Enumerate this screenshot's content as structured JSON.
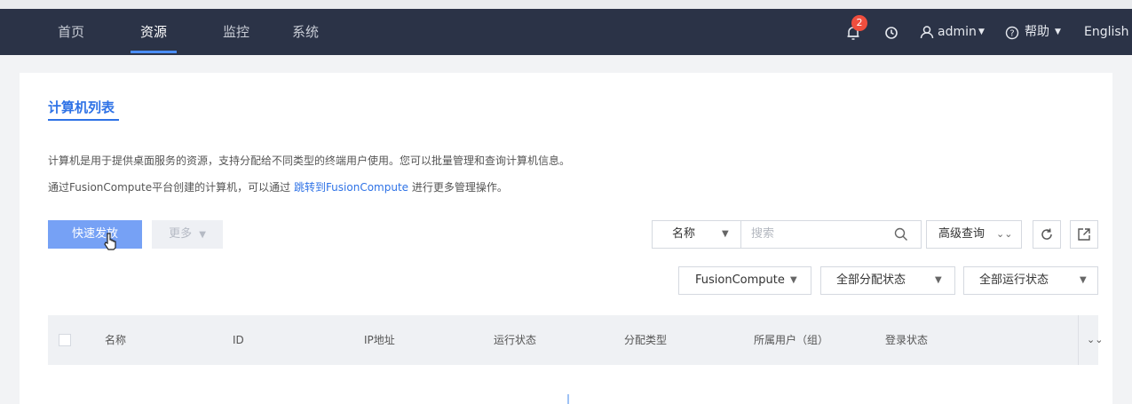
{
  "nav": {
    "tabs": [
      {
        "label": "首页"
      },
      {
        "label": "资源",
        "active": true
      },
      {
        "label": "监控"
      },
      {
        "label": "系统"
      }
    ],
    "notification_count": "2",
    "user": "admin",
    "help": "帮助",
    "language": "English"
  },
  "page": {
    "title": "计算机列表",
    "desc_line1": "计算机是用于提供桌面服务的资源，支持分配给不同类型的终端用户使用。您可以批量管理和查询计算机信息。",
    "desc_line2_prefix": "通过FusionCompute平台创建的计算机，可以通过",
    "desc_line2_link": "跳转到FusionCompute",
    "desc_line2_suffix": "进行更多管理操作。"
  },
  "toolbar": {
    "quick_dispatch": "快速发放",
    "more": "更多",
    "search_field": "名称",
    "search_placeholder": "搜索",
    "advanced": "高级查询",
    "filter_platform": "FusionCompute",
    "filter_assign": "全部分配状态",
    "filter_run": "全部运行状态"
  },
  "table": {
    "columns": [
      "名称",
      "ID",
      "IP地址",
      "运行状态",
      "分配类型",
      "所属用户（组）",
      "登录状态"
    ]
  },
  "colors": {
    "navbar": "#2b3347",
    "accent": "#2e72e6",
    "primary_button": "#76a1f5",
    "badge": "#f04e3e"
  }
}
